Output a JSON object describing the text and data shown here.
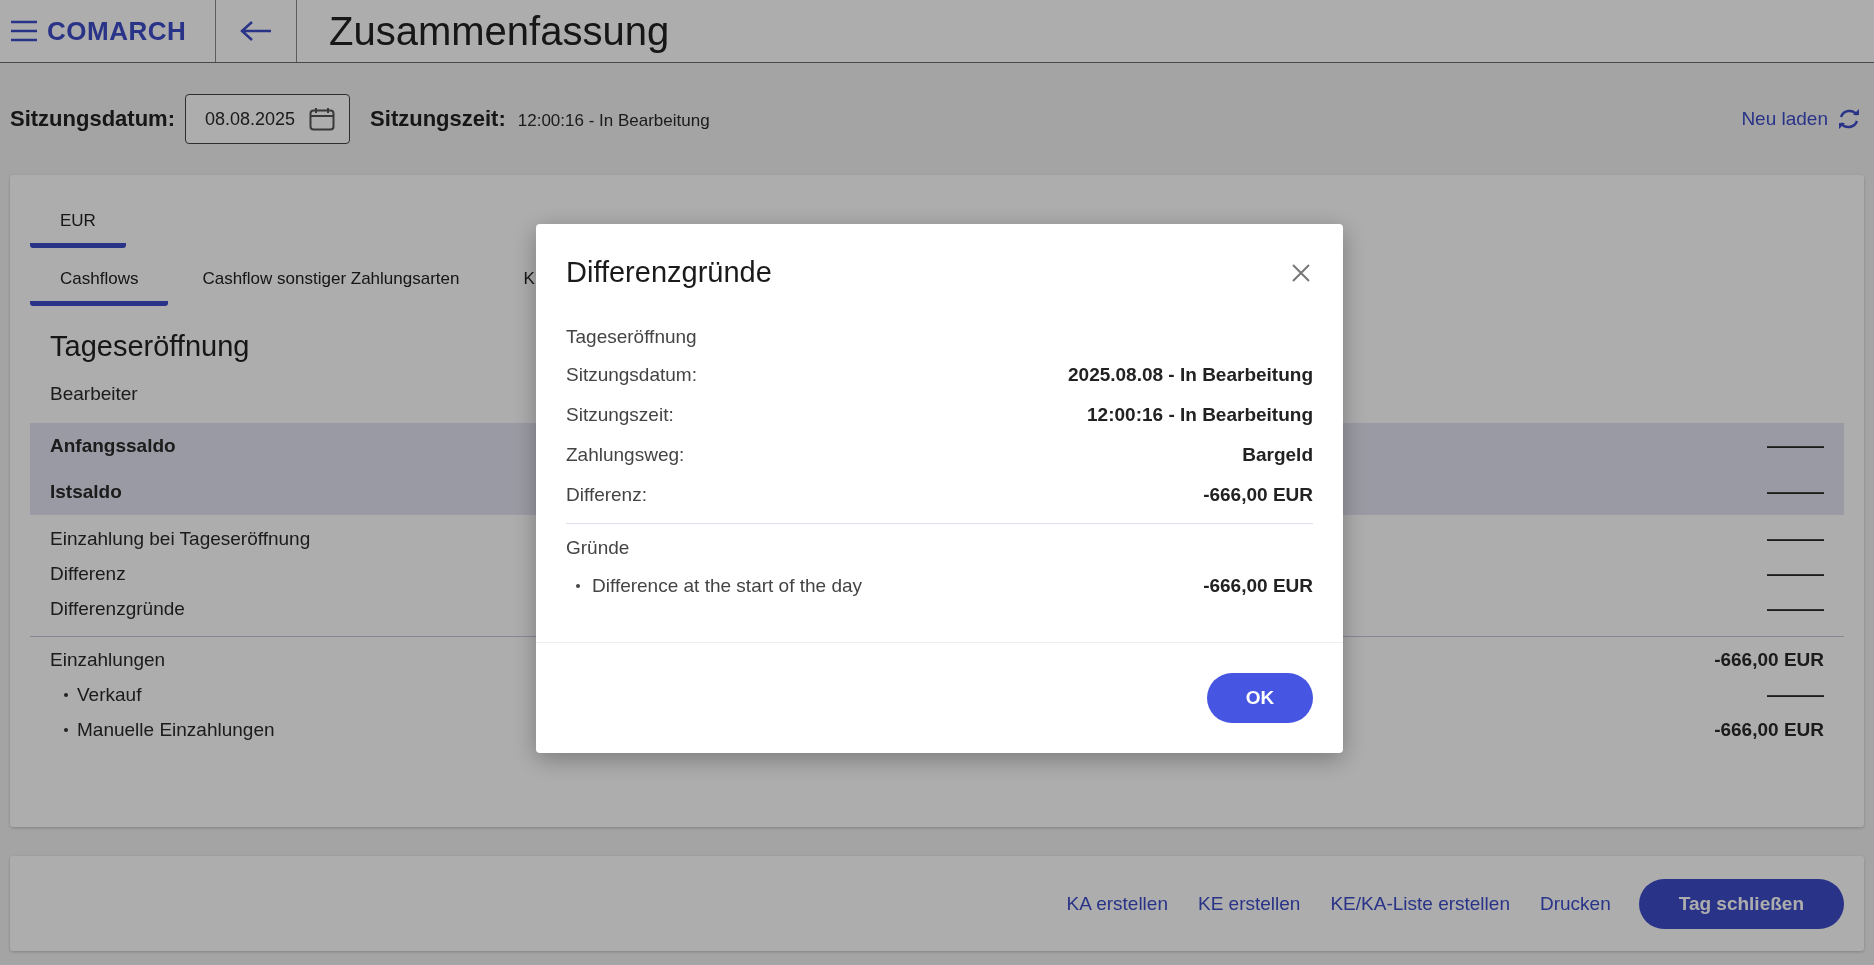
{
  "header": {
    "logo": "COMARCH",
    "title": "Zusammenfassung"
  },
  "session": {
    "date_label": "Sitzungsdatum:",
    "date_value": "08.08.2025",
    "time_label": "Sitzungszeit:",
    "time_value": "12:00:16 - In Bearbeitung",
    "reload": "Neu laden"
  },
  "currency_tabs": [
    {
      "label": "EUR",
      "selected": true
    }
  ],
  "tabs": [
    {
      "label": "Cashflows",
      "selected": true
    },
    {
      "label": "Cashflow sonstiger Zahlungsarten",
      "selected": false
    },
    {
      "label": "K",
      "selected": false
    }
  ],
  "section": {
    "title": "Tageseröffnung",
    "groups": [
      {
        "rows": [
          {
            "kind": "plain",
            "label": "Bearbeiter"
          },
          {
            "kind": "total",
            "label": "Anfangssaldo",
            "value": "———"
          },
          {
            "kind": "total",
            "label": "Istsaldo",
            "value": "———"
          },
          {
            "kind": "plain",
            "label": "Einzahlung bei Tageseröffnung",
            "value": "———"
          },
          {
            "kind": "plain",
            "label": "Differenz",
            "value": "———"
          },
          {
            "kind": "plain",
            "label": "Differenzgründe",
            "value": "———"
          }
        ]
      },
      {
        "rows": [
          {
            "kind": "plain",
            "label": "Einzahlungen",
            "value": "-666,00 EUR"
          },
          {
            "kind": "bullet",
            "label": "Verkauf",
            "value": "———"
          },
          {
            "kind": "bullet",
            "label": "Manuelle Einzahlungen",
            "value": "-666,00 EUR"
          }
        ]
      }
    ]
  },
  "actions": [
    {
      "kind": "link",
      "label": "KA erstellen"
    },
    {
      "kind": "link",
      "label": "KE erstellen"
    },
    {
      "kind": "link",
      "label": "KE/KA-Liste erstellen"
    },
    {
      "kind": "link",
      "label": "Drucken"
    },
    {
      "kind": "primary",
      "label": "Tag schließen"
    }
  ],
  "dialog": {
    "title": "Differenzgründe",
    "subtitle": "Tageseröffnung",
    "fields": [
      {
        "label": "Sitzungsdatum:",
        "value": "2025.08.08 - In Bearbeitung"
      },
      {
        "label": "Sitzungszeit:",
        "value": "12:00:16 - In Bearbeitung"
      },
      {
        "label": "Zahlungsweg:",
        "value": "Bargeld"
      },
      {
        "label": "Differenz:",
        "value": "-666,00 EUR"
      }
    ],
    "reasons_title": "Gründe",
    "reasons": [
      {
        "label": "Difference at the start of the day",
        "value": "-666,00 EUR"
      }
    ],
    "button": "OK"
  }
}
